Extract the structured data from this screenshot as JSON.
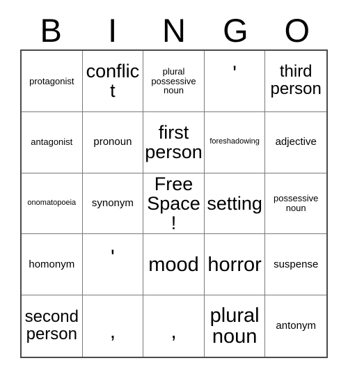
{
  "card": {
    "title": "Bingo Card",
    "header_letters": [
      "B",
      "I",
      "N",
      "G",
      "O"
    ],
    "grid_size": "5x5",
    "colors": {
      "background": "#ffffff",
      "text": "#000000",
      "inner_border": "#7a7a7a",
      "outer_border": "#4a4a4a"
    },
    "rows": [
      [
        {
          "label": "protagonist",
          "size": "sz-xs"
        },
        {
          "label": "conflict",
          "size": "sz-lg"
        },
        {
          "label": "plural possessive noun",
          "size": "sz-xs"
        },
        {
          "label": "'",
          "size": "sz-punct-apos"
        },
        {
          "label": "third person",
          "size": "sz-md"
        }
      ],
      [
        {
          "label": "antagonist",
          "size": "sz-xs"
        },
        {
          "label": "pronoun",
          "size": "sz-sm"
        },
        {
          "label": "first person",
          "size": "sz-lg"
        },
        {
          "label": "foreshadowing",
          "size": "sz-xxs"
        },
        {
          "label": "adjective",
          "size": "sz-sm"
        }
      ],
      [
        {
          "label": "onomatopoeia",
          "size": "sz-xxs"
        },
        {
          "label": "synonym",
          "size": "sz-sm"
        },
        {
          "label": "Free Space!",
          "size": "sz-lg"
        },
        {
          "label": "setting",
          "size": "sz-lg"
        },
        {
          "label": "possessive noun",
          "size": "sz-xs"
        }
      ],
      [
        {
          "label": "homonym",
          "size": "sz-sm"
        },
        {
          "label": "'",
          "size": "sz-punct-apos"
        },
        {
          "label": "mood",
          "size": "sz-xl"
        },
        {
          "label": "horror",
          "size": "sz-xl"
        },
        {
          "label": "suspense",
          "size": "sz-sm"
        }
      ],
      [
        {
          "label": "second person",
          "size": "sz-md"
        },
        {
          "label": ",",
          "size": "sz-punct-comma"
        },
        {
          "label": ",",
          "size": "sz-punct-comma"
        },
        {
          "label": "plural noun",
          "size": "sz-xl"
        },
        {
          "label": "antonym",
          "size": "sz-sm"
        }
      ]
    ]
  }
}
